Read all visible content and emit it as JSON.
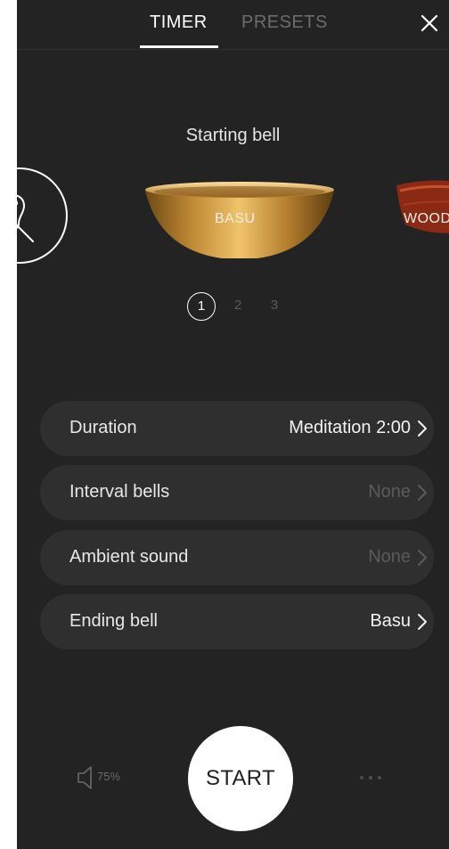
{
  "tabs": {
    "timer": "TIMER",
    "presets": "PRESETS"
  },
  "starting_bell": {
    "title": "Starting bell",
    "bells": [
      {
        "label": "BASU"
      },
      {
        "label": "WOOD"
      }
    ],
    "pages": [
      "1",
      "2",
      "3"
    ],
    "active_page": "1"
  },
  "settings": [
    {
      "label": "Duration",
      "value": "Meditation 2:00"
    },
    {
      "label": "Interval bells",
      "value": "None"
    },
    {
      "label": "Ambient sound",
      "value": "None"
    },
    {
      "label": "Ending bell",
      "value": "Basu"
    }
  ],
  "footer": {
    "volume": "75%",
    "start": "START"
  },
  "icons": {
    "close": "close-icon",
    "no_bell": "no-bell-icon",
    "speaker": "speaker-icon",
    "more": "more-dots-icon",
    "chevron": "chevron-right-icon"
  },
  "colors": {
    "background": "#232323",
    "row": "#2f2f2f",
    "accent": "#ffffff",
    "muted": "#5a5a5a"
  }
}
